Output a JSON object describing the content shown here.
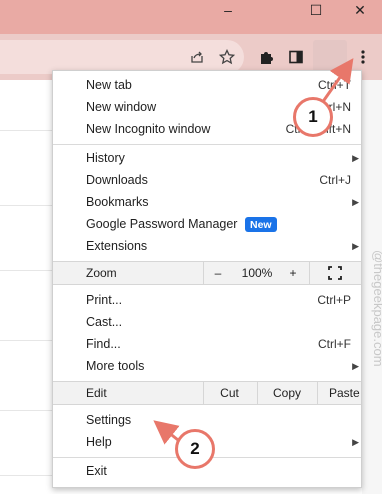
{
  "window": {
    "minimize_glyph": "–",
    "maximize_glyph": "☐",
    "close_glyph": "✕"
  },
  "toolbar": {
    "share_icon": "share-icon",
    "star_icon": "bookmark-star-icon",
    "extensions_icon": "puzzle-icon",
    "sidepanel_icon": "side-panel-icon",
    "menu_icon": "more-vert-icon"
  },
  "menu": {
    "new_tab": {
      "label": "New tab",
      "shortcut": "Ctrl+T"
    },
    "new_window": {
      "label": "New window",
      "shortcut": "Ctrl+N"
    },
    "incognito": {
      "label": "New Incognito window",
      "shortcut": "Ctrl+Shift+N"
    },
    "history": {
      "label": "History"
    },
    "downloads": {
      "label": "Downloads",
      "shortcut": "Ctrl+J"
    },
    "bookmarks": {
      "label": "Bookmarks"
    },
    "password_manager": {
      "label": "Google Password Manager",
      "badge": "New"
    },
    "extensions": {
      "label": "Extensions"
    },
    "zoom": {
      "label": "Zoom",
      "minus": "–",
      "level": "100%",
      "plus": "+"
    },
    "print": {
      "label": "Print...",
      "shortcut": "Ctrl+P"
    },
    "cast": {
      "label": "Cast..."
    },
    "find": {
      "label": "Find...",
      "shortcut": "Ctrl+F"
    },
    "more_tools": {
      "label": "More tools"
    },
    "edit": {
      "label": "Edit",
      "cut": "Cut",
      "copy": "Copy",
      "paste": "Paste"
    },
    "settings": {
      "label": "Settings"
    },
    "help": {
      "label": "Help"
    },
    "exit": {
      "label": "Exit"
    }
  },
  "annotations": {
    "callout_1": "1",
    "callout_2": "2",
    "accent_color": "#e8776a"
  },
  "watermark": "@thegeekpage.com"
}
